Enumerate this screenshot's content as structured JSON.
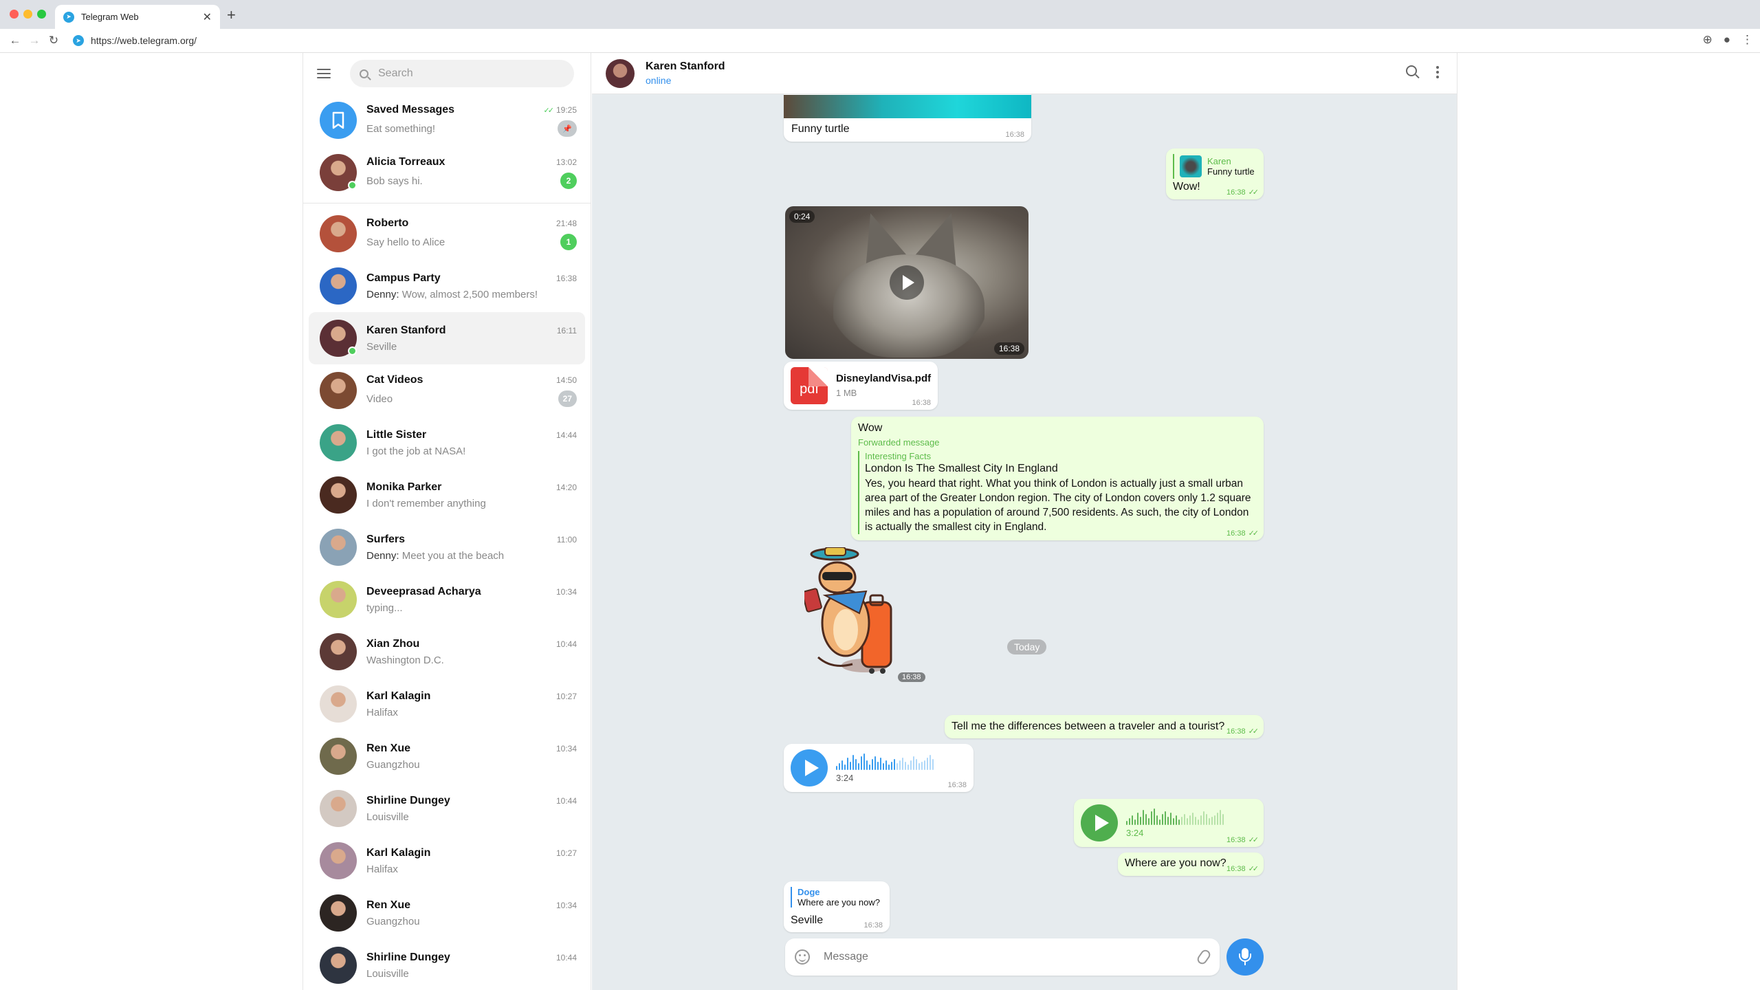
{
  "browser": {
    "tab_title": "Telegram Web",
    "tab_close": "✕",
    "new_tab": "+",
    "url": "https://web.telegram.org/"
  },
  "sidebar": {
    "search_placeholder": "Search",
    "chats": [
      {
        "name": "Saved Messages",
        "time": "19:25",
        "message": "Eat something!",
        "badge": "",
        "pinned": true,
        "avatar": "bookmark-icon",
        "color": "#3a9df0"
      },
      {
        "name": "Alicia Torreaux",
        "time": "13:02",
        "message": "Bob says hi.",
        "badge": "2",
        "online": true,
        "color": "#7a3f3a"
      },
      {
        "name": "Roberto",
        "time": "21:48",
        "message": "Say hello to Alice",
        "badge": "1",
        "color": "#b4513b"
      },
      {
        "name": "Campus Party",
        "time": "16:38",
        "sender": "Denny:",
        "message": "Wow, almost 2,500 members!",
        "badge": "",
        "color": "#2b67c4"
      },
      {
        "name": "Karen Stanford",
        "time": "16:11",
        "message": "Seville",
        "badge": "",
        "online": true,
        "active": true,
        "color": "#5b2f35"
      },
      {
        "name": "Cat Videos",
        "time": "14:50",
        "message": "Video",
        "badge": "27",
        "muted": true,
        "color": "#7c4a32"
      },
      {
        "name": "Little Sister",
        "time": "14:44",
        "message": "I got the job at NASA!",
        "badge": "",
        "color": "#3aa387"
      },
      {
        "name": "Monika Parker",
        "time": "14:20",
        "message": "I don't remember anything",
        "badge": "",
        "color": "#4a2a20"
      },
      {
        "name": "Surfers",
        "time": "11:00",
        "sender": "Denny:",
        "message": "Meet you at the beach",
        "badge": "",
        "color": "#8aa2b5"
      },
      {
        "name": "Deveeprasad Acharya",
        "time": "10:34",
        "message": "typing...",
        "badge": "",
        "color": "#c7d36b"
      },
      {
        "name": "Xian Zhou",
        "time": "10:44",
        "message": "Washington D.C.",
        "badge": "",
        "color": "#5c3a36"
      },
      {
        "name": "Karl Kalagin",
        "time": "10:27",
        "message": "Halifax",
        "badge": "",
        "color": "#e6ddd6"
      },
      {
        "name": "Ren Xue",
        "time": "10:34",
        "message": "Guangzhou",
        "badge": "",
        "color": "#6f6a4c"
      },
      {
        "name": "Shirline Dungey",
        "time": "10:44",
        "message": "Louisville",
        "badge": "",
        "color": "#d3c9c2"
      },
      {
        "name": "Karl Kalagin",
        "time": "10:27",
        "message": "Halifax",
        "badge": "",
        "color": "#a78a9d"
      },
      {
        "name": "Ren Xue",
        "time": "10:34",
        "message": "Guangzhou",
        "badge": "",
        "color": "#2c2522"
      },
      {
        "name": "Shirline Dungey",
        "time": "10:44",
        "message": "Louisville",
        "badge": "",
        "color": "#2e3440"
      }
    ]
  },
  "header": {
    "name": "Karen Stanford",
    "status": "online"
  },
  "messages": {
    "turtle_caption": "Funny turtle",
    "turtle_time": "16:38",
    "reply1_name": "Karen",
    "reply1_text": "Funny turtle",
    "reply1_msg": "Wow!",
    "reply1_time": "16:38",
    "video_duration": "0:24",
    "video_time": "16:38",
    "file_name": "DisneylandVisa.pdf",
    "file_size": "1 MB",
    "file_ext": "pdf",
    "file_time": "16:38",
    "fwd_text": "Wow",
    "fwd_label": "Forwarded message",
    "fwd_source": "Interesting Facts",
    "fwd_title": "London Is The Smallest City In England",
    "fwd_body": "Yes, you heard that right. What you think of London is actually just a small urban area part of the Greater London region. The city of London covers only 1.2 square miles and has a population of around 7,500 residents. As such, the city of London is actually the smallest city in England.",
    "fwd_time": "16:38",
    "sticker_time": "16:38",
    "date_label": "Today",
    "question": "Tell me the differences between a traveler and a tourist?",
    "question_time": "16:38",
    "voice_in_duration": "3:24",
    "voice_in_time": "16:38",
    "voice_out_duration": "3:24",
    "voice_out_time": "16:38",
    "where": "Where are you now?",
    "where_time": "16:38",
    "reply2_name": "Doge",
    "reply2_text": "Where are you now?",
    "reply2_msg": "Seville",
    "reply2_time": "16:38"
  },
  "composer": {
    "placeholder": "Message"
  },
  "colors": {
    "accent": "#3390ec",
    "outgoing_bubble": "#eeffde",
    "chat_background": "#e6ebee",
    "unread_badge": "#4fce5d"
  }
}
